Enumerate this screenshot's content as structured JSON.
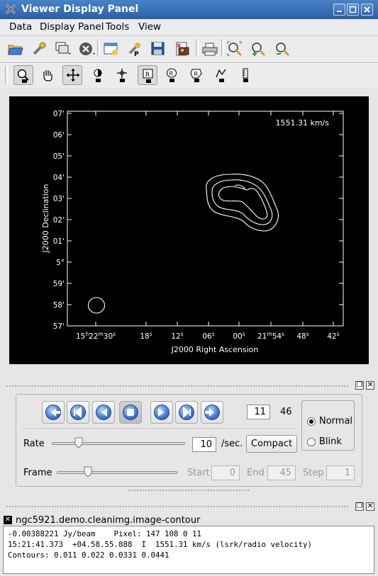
{
  "window": {
    "title": "Viewer Display Panel",
    "icon": "casa-x-icon"
  },
  "window_buttons": [
    "minimize",
    "maximize",
    "close"
  ],
  "menubar": {
    "items": [
      {
        "label": "Data"
      },
      {
        "label": "Display Panel"
      },
      {
        "label": "Tools"
      },
      {
        "label": "View"
      }
    ]
  },
  "main_toolbar": {
    "icons": [
      "open-folder-icon",
      "wrench-icon",
      "new-panel-icon",
      "close-panel-icon",
      "panel-settings-icon",
      "print-setup-icon",
      "save-icon",
      "save-image-icon",
      "print-icon",
      "zoom-fit-icon",
      "zoom-in-icon",
      "zoom-out-icon"
    ]
  },
  "mouse_toolbar": {
    "pressed": [
      0,
      2,
      5
    ],
    "icons": [
      "zoom-tool-icon",
      "pan-hand-icon",
      "move-cross-icon",
      "contrast-icon",
      "crosshair-point-icon",
      "rectangle-region-icon",
      "ellipse-region-icon",
      "polygon-region-icon",
      "polyline-icon",
      "ruler-icon"
    ]
  },
  "display": {
    "velocity_label": "1551.31 km/s",
    "xlabel": "J2000 Right Ascension",
    "ylabel": "J2000 Declination",
    "y_ticks": [
      "07'",
      "06'",
      "05'",
      "04'",
      "03'",
      "02'",
      "01'",
      "5°",
      "59'",
      "58'",
      "57'"
    ],
    "x_ticks": [
      {
        "main": "15",
        "sup1": "h",
        "mid": "22",
        "sup2": "m",
        "end": "30",
        "sup3": "s"
      },
      {
        "main": "18",
        "sup3": "s"
      },
      {
        "main": "12",
        "sup3": "s"
      },
      {
        "main": "06",
        "sup3": "s"
      },
      {
        "main": "00",
        "sup3": "s"
      },
      {
        "main": "21",
        "sup2": "m",
        "end": "54",
        "sup3": "s"
      },
      {
        "main": "48",
        "sup3": "s"
      },
      {
        "main": "42",
        "sup3": "s"
      }
    ],
    "contour_levels": [
      "0.011",
      "0.022",
      "0.0331",
      "0.0441"
    ]
  },
  "animator": {
    "nav_buttons": [
      "to-start-icon",
      "rewind-icon",
      "step-back-icon",
      "stop-icon",
      "step-forward-icon",
      "fast-forward-icon",
      "to-end-icon"
    ],
    "frame_value": "11",
    "frame_total": "46",
    "mode_options": [
      {
        "label": "Normal",
        "selected": true
      },
      {
        "label": "Blink",
        "selected": false
      }
    ],
    "rate_label": "Rate",
    "rate_value": "10",
    "rate_unit": "/sec.",
    "compact_button": "Compact",
    "frame_label": "Frame",
    "start_label": "Start",
    "start_value": "0",
    "end_label": "End",
    "end_value": "45",
    "step_label": "Step",
    "step_value": "1",
    "rate_slider_fraction": 0.2,
    "frame_slider_fraction": 0.26
  },
  "output_panel": {
    "title": "ngc5921.demo.cleanimg.image-contour",
    "lines": [
      "-0.00388221 Jy/beam    Pixel: 147 108 0 11",
      "15:21:41.373  +04.58.55.888  I  1551.31 km/s (lsrk/radio velocity)",
      "Contours: 0.011 0.022 0.0331 0.0441"
    ]
  },
  "colors": {
    "titlebar": "#3a72bb",
    "canvas": "#000000",
    "contours": "#ffffff",
    "nav_button": "#3b76d8"
  }
}
